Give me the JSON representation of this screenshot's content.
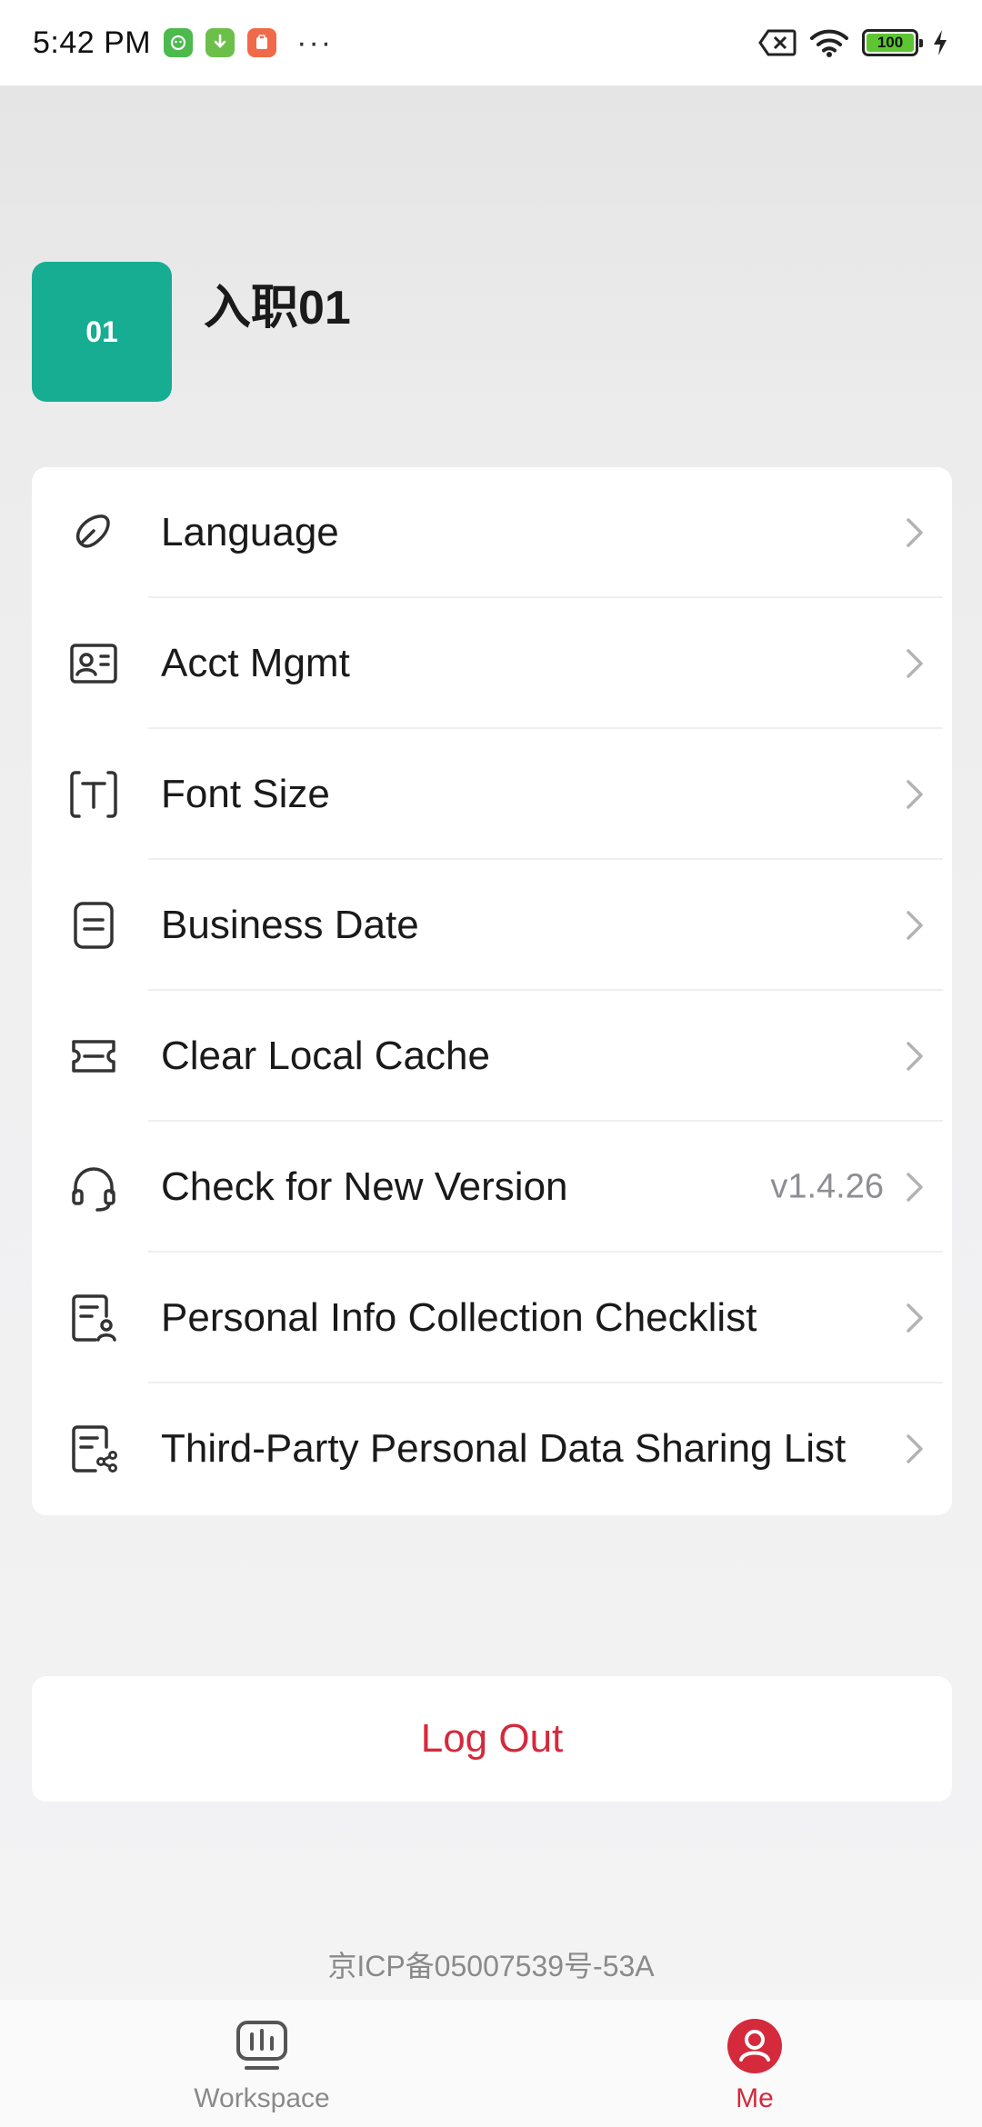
{
  "status_bar": {
    "time": "5:42 PM",
    "battery": "100",
    "overflow": "···"
  },
  "profile": {
    "avatar_text": "01",
    "name": "入职01"
  },
  "menu": {
    "items": [
      {
        "label": "Language",
        "icon": "tag-icon"
      },
      {
        "label": "Acct Mgmt",
        "icon": "id-card-icon"
      },
      {
        "label": "Font Size",
        "icon": "text-size-icon"
      },
      {
        "label": "Business Date",
        "icon": "document-icon"
      },
      {
        "label": "Clear Local Cache",
        "icon": "ticket-icon"
      },
      {
        "label": "Check for New Version",
        "icon": "headset-icon",
        "value": "v1.4.26"
      },
      {
        "label": "Personal Info Collection Checklist",
        "icon": "user-list-icon"
      },
      {
        "label": "Third-Party Personal Data Sharing List",
        "icon": "share-list-icon"
      }
    ]
  },
  "logout_label": "Log Out",
  "icp": "京ICP备05007539号-53A",
  "tabbar": {
    "workspace": "Workspace",
    "me": "Me"
  },
  "colors": {
    "accent": "#d42a3c",
    "avatar": "#16ad93"
  }
}
